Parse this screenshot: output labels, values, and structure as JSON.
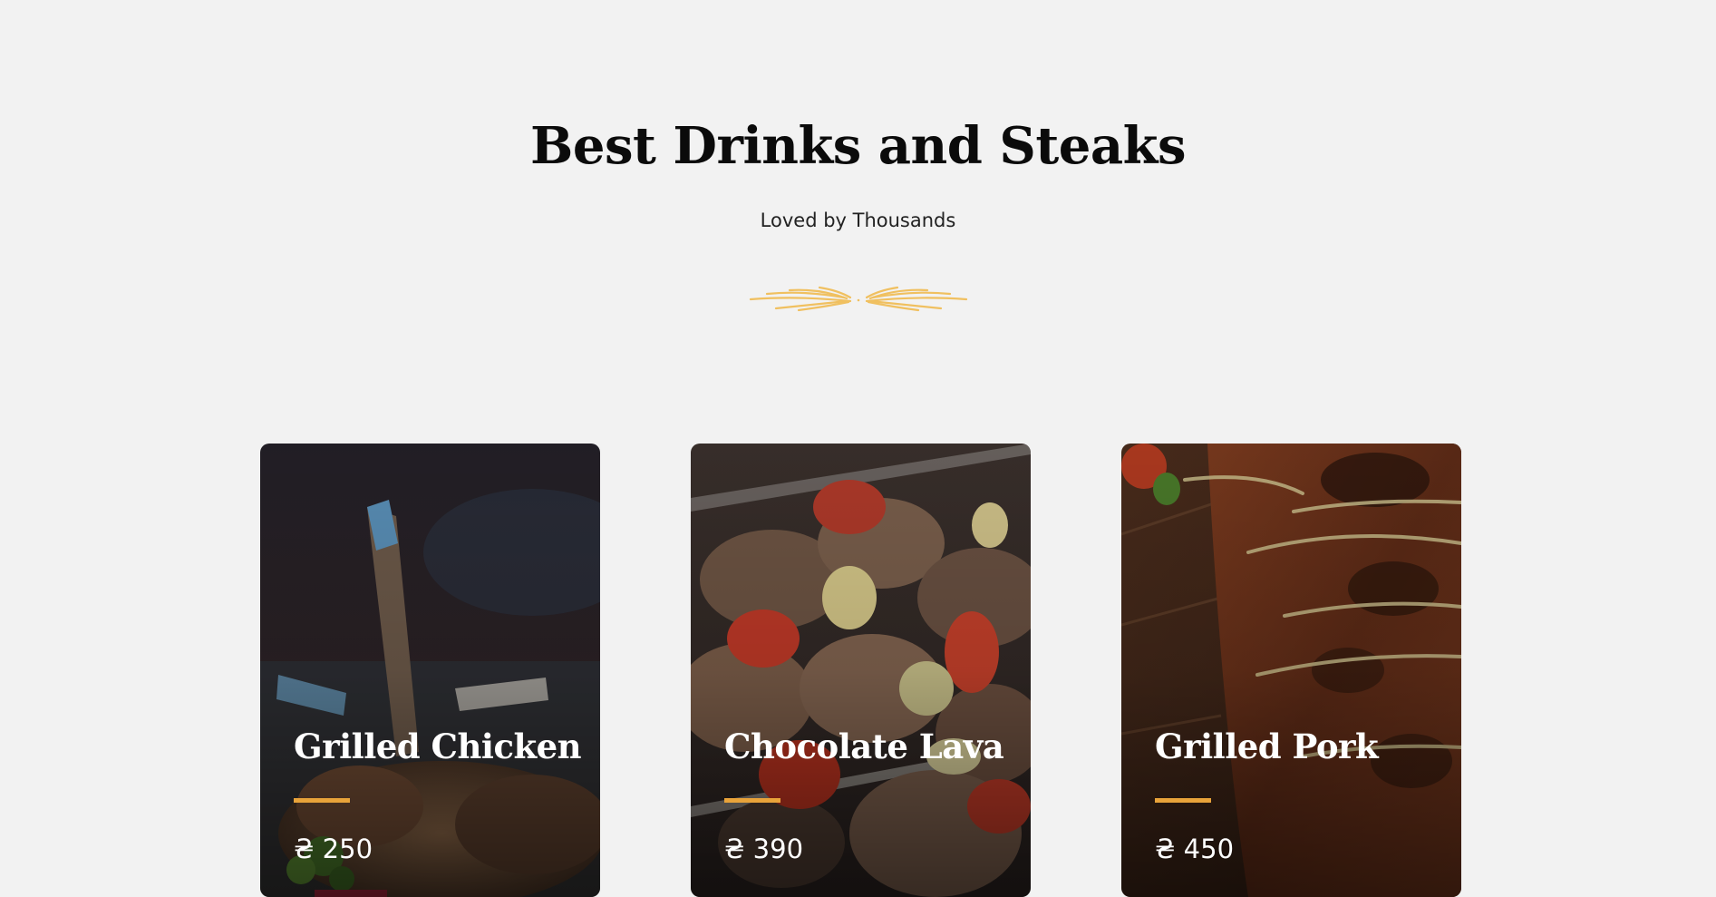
{
  "section": {
    "title": "Best Drinks and Steaks",
    "subtitle": "Loved by Thousands"
  },
  "colors": {
    "background": "#f2f2f2",
    "accent": "#e8a33a",
    "ornament": "#f0c060",
    "title": "#0b0b0b"
  },
  "divider_icon": "wheat-ornament-icon",
  "cards": [
    {
      "name": "Grilled Chicken",
      "price": "₴ 250"
    },
    {
      "name": "Chocolate Lava",
      "price": "₴ 390"
    },
    {
      "name": "Grilled Pork",
      "price": "₴ 450"
    }
  ]
}
